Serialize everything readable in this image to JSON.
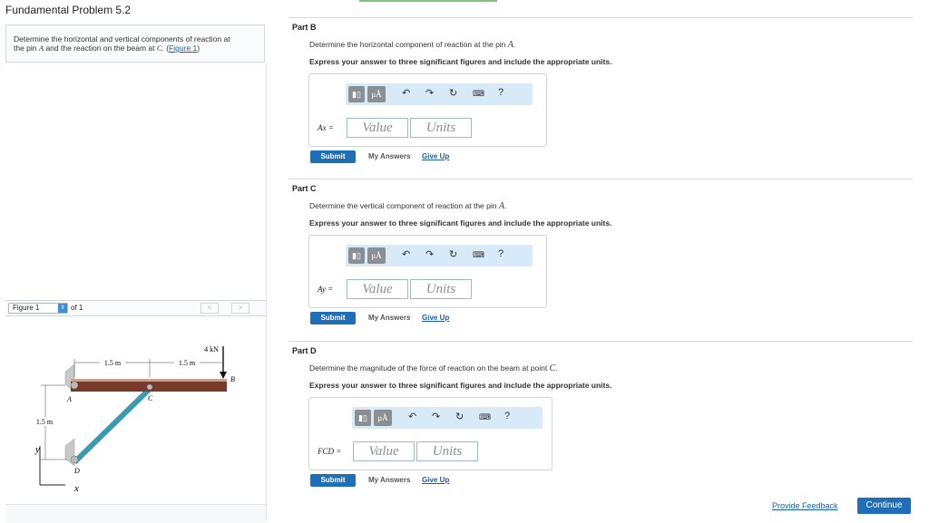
{
  "problem": {
    "title": "Fundamental Problem 5.2",
    "statement_line1": "Determine the horizontal and vertical components of reaction at",
    "statement_line2_a": "the pin ",
    "statement_line2_var": "A",
    "statement_line2_b": " and the reaction on the beam at ",
    "statement_line2_var2": "C",
    "statement_line2_c": ". (",
    "figure_link": "Figure 1",
    "statement_line2_d": ")"
  },
  "figure_nav": {
    "selected": "Figure 1",
    "of_label": "of 1",
    "prev": "<",
    "next": ">"
  },
  "figure": {
    "dim1": "1.5 m",
    "dim2": "1.5 m",
    "load": "4 kN",
    "height": "1.5 m",
    "label_A": "A",
    "label_B": "B",
    "label_C": "C",
    "label_D": "D",
    "axis_x": "x",
    "axis_y": "y",
    "beam_color": "#7a3a2a",
    "strut_color": "#3a9ab0"
  },
  "parts": [
    {
      "label": "Part B",
      "instruction_a": "Determine the horizontal component of reaction at the pin ",
      "instruction_var": "A",
      "instruction_b": ".",
      "express": "Express your answer to three significant figures and include the appropriate units.",
      "var_label": "Ax =",
      "value_placeholder": "Value",
      "units_placeholder": "Units",
      "submit": "Submit",
      "my_answers": "My Answers",
      "give_up": "Give Up"
    },
    {
      "label": "Part C",
      "instruction_a": "Determine the vertical component of reaction at the pin ",
      "instruction_var": "A",
      "instruction_b": ".",
      "express": "Express your answer to three significant figures and include the appropriate units.",
      "var_label": "Ay =",
      "value_placeholder": "Value",
      "units_placeholder": "Units",
      "submit": "Submit",
      "my_answers": "My Answers",
      "give_up": "Give Up"
    },
    {
      "label": "Part D",
      "instruction_a": "Determine the magnitude of the force of reaction on the beam at point ",
      "instruction_var": "C",
      "instruction_b": ".",
      "express": "Express your answer to three significant figures and include the appropriate units.",
      "var_label": "FCD =",
      "value_placeholder": "Value",
      "units_placeholder": "Units",
      "submit": "Submit",
      "my_answers": "My Answers",
      "give_up": "Give Up"
    }
  ],
  "toolbar": {
    "mu_label": "μÅ",
    "help": "?"
  },
  "footer": {
    "feedback": "Provide Feedback",
    "continue": "Continue"
  }
}
